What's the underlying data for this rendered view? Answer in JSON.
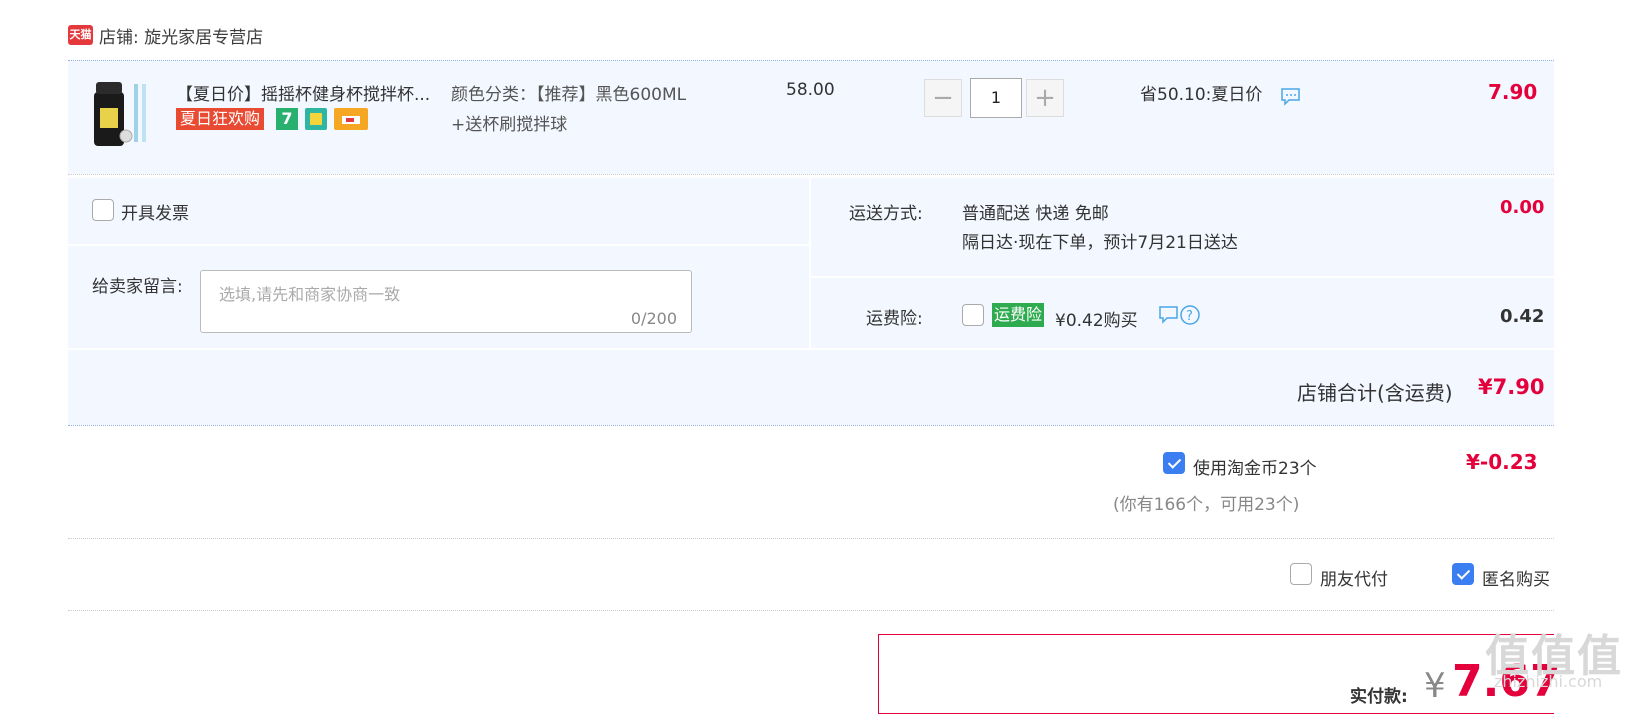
{
  "shop": {
    "badge": "天猫",
    "label": "店铺: 旋光家居专营店"
  },
  "item": {
    "title": "【夏日价】摇摇杯健身杯搅拌杯...",
    "promo_badge": "夏日狂欢购",
    "badge_7": "7",
    "variant_line1": "颜色分类：【推荐】黑色600ML",
    "variant_line2": "+送杯刷搅拌球",
    "unit_price": "58.00",
    "quantity": "1",
    "minus": "−",
    "plus": "+",
    "discount": "省50.10:夏日价",
    "total": "7.90"
  },
  "invoice": {
    "label": "开具发票",
    "checked": false
  },
  "shipping": {
    "label": "运送方式:",
    "method": "普通配送 快递 免邮",
    "eta": "隔日达·现在下单，预计7月21日送达",
    "cost": "0.00"
  },
  "message": {
    "label": "给卖家留言:",
    "placeholder": "选填,请先和商家协商一致",
    "counter": "0/200"
  },
  "insurance": {
    "label": "运费险:",
    "tag": "运费险",
    "price_text": "¥0.42购买",
    "cost": "0.42",
    "checked": false
  },
  "store_total": {
    "label": "店铺合计(含运费)",
    "value": "¥7.90"
  },
  "coins": {
    "label": "使用淘金币23个",
    "sub": "(你有166个，可用23个)",
    "value": "¥-0.23",
    "checked": true
  },
  "options": {
    "friend_pay": "朋友代付",
    "friend_pay_checked": false,
    "anonymous": "匿名购买",
    "anonymous_checked": true
  },
  "payment": {
    "label": "实付款:",
    "currency": "¥",
    "amount": "7.67"
  },
  "watermark": {
    "text": "值值值",
    "sub": "zhizhizhi.com"
  },
  "colors": {
    "accent_red": "#e4003a",
    "panel_bg": "#f3f7ff",
    "checkbox_blue": "#3a7ef2",
    "insurance_green": "#2eab4f"
  }
}
